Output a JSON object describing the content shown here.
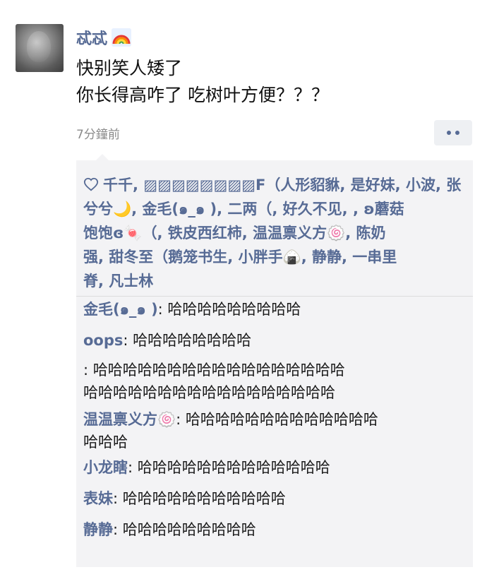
{
  "post": {
    "author": "忒忒",
    "author_icon": "rainbow-icon",
    "text_lines": [
      "快别笑人矮了",
      "你长得高咋了 吃树叶方便？？？"
    ],
    "timestamp": "7分鐘前",
    "more_icon": "more-dots-icon"
  },
  "likes": {
    "icon": "heart-icon",
    "lines": [
      "千千, ▨▨▨▨▨▨▨▨F（人形貂貅, 是好妹, 小波, 张",
      "兮兮🌙, 金毛(๑_๑ ), 二两（, 好久不见, , ʚ蘑菇",
      "饱饱ɞ🍬（, 铁皮西红柿, 温温禀义方🍥, 陈奶",
      "强, 甜冬至（鹅笼书生, 小胖手🍙, 静静, 一串里",
      "脊, 凡士林"
    ]
  },
  "comments": [
    {
      "name": "金毛(๑_๑ )",
      "text_lines": [
        ": 哈哈哈哈哈哈哈哈哈"
      ]
    },
    {
      "name": "oops",
      "text_lines": [
        ": 哈哈哈哈哈哈哈哈"
      ]
    },
    {
      "name": "",
      "text_lines": [
        ": 哈哈哈哈哈哈哈哈哈哈哈哈哈哈哈哈哈",
        "哈哈哈哈哈哈哈哈哈哈哈哈哈哈哈哈哈"
      ]
    },
    {
      "name": "温温禀义方🍥",
      "text_lines": [
        ": 哈哈哈哈哈哈哈哈哈哈哈哈哈",
        "哈哈哈"
      ]
    },
    {
      "name": "小龙瞎",
      "text_lines": [
        ": 哈哈哈哈哈哈哈哈哈哈哈哈哈"
      ]
    },
    {
      "name": "表妹",
      "text_lines": [
        ": 哈哈哈哈哈哈哈哈哈哈哈"
      ]
    },
    {
      "name": "静静",
      "text_lines": [
        ": 哈哈哈哈哈哈哈哈哈"
      ]
    }
  ],
  "colors": {
    "link": "#576b95",
    "background": "#ffffff",
    "box": "#f3f3f5"
  }
}
